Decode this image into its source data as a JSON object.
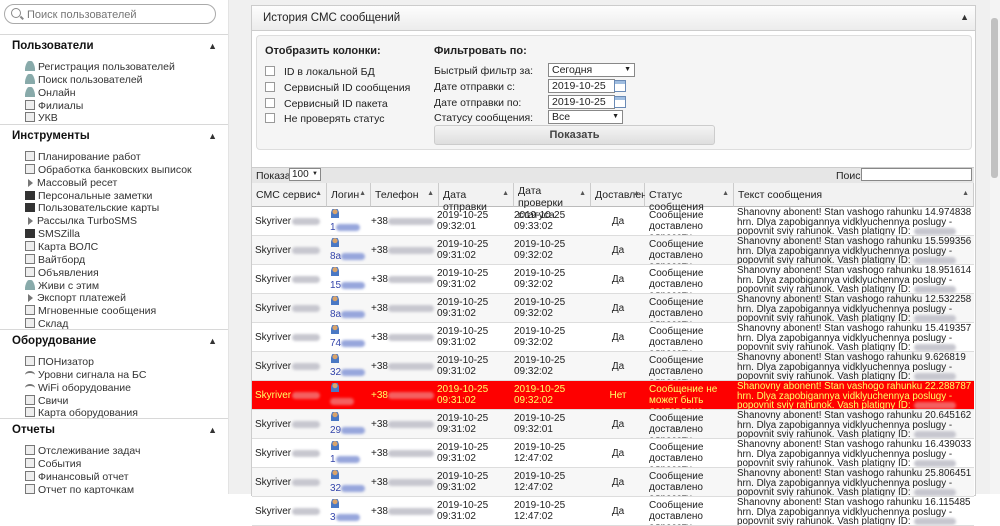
{
  "sidebar": {
    "search_placeholder": "Поиск пользователей",
    "sections": [
      {
        "title": "Пользователи",
        "items": [
          {
            "label": "Регистрация пользователей",
            "icon": "person-icon"
          },
          {
            "label": "Поиск пользователей",
            "icon": "person-icon"
          },
          {
            "label": "Онлайн",
            "icon": "people-icon"
          },
          {
            "label": "Филиалы",
            "icon": "folders-icon"
          },
          {
            "label": "УКВ",
            "icon": "box-icon"
          }
        ]
      },
      {
        "title": "Инструменты",
        "items": [
          {
            "label": "Планирование работ",
            "icon": "calendar-icon"
          },
          {
            "label": "Обработка банковских выписок",
            "icon": "bank-icon"
          },
          {
            "label": "Массовый ресет",
            "icon": "arrow-icon"
          },
          {
            "label": "Персональные заметки",
            "icon": "notes-icon"
          },
          {
            "label": "Пользовательские карты",
            "icon": "cards-icon"
          },
          {
            "label": "Рассылка TurboSMS",
            "icon": "arrow-icon"
          },
          {
            "label": "SMSZilla",
            "icon": "sms-icon"
          },
          {
            "label": "Карта ВОЛС",
            "icon": "map-icon"
          },
          {
            "label": "Вайтборд",
            "icon": "board-icon"
          },
          {
            "label": "Объявления",
            "icon": "announce-icon"
          },
          {
            "label": "Живи с этим",
            "icon": "people-icon"
          },
          {
            "label": "Экспорт платежей",
            "icon": "arrow-icon"
          },
          {
            "label": "Мгновенные сообщения",
            "icon": "chat-icon"
          },
          {
            "label": "Склад",
            "icon": "warehouse-icon"
          }
        ]
      },
      {
        "title": "Оборудование",
        "items": [
          {
            "label": "ПОНизатор",
            "icon": "device-icon"
          },
          {
            "label": "Уровни сигнала на БС",
            "icon": "signal-icon"
          },
          {
            "label": "WiFi оборудование",
            "icon": "wifi-icon"
          },
          {
            "label": "Свичи",
            "icon": "switch-icon"
          },
          {
            "label": "Карта оборудования",
            "icon": "map-icon"
          }
        ]
      },
      {
        "title": "Отчеты",
        "items": [
          {
            "label": "Отслеживание задач",
            "icon": "tasks-icon"
          },
          {
            "label": "События",
            "icon": "events-icon"
          },
          {
            "label": "Финансовый отчет",
            "icon": "finance-icon"
          },
          {
            "label": "Отчет по карточкам",
            "icon": "report-icon"
          }
        ]
      }
    ]
  },
  "panel": {
    "title": "История СМС сообщений",
    "columns_heading": "Отобразить колонки:",
    "filter_heading": "Фильтровать по:",
    "checkboxes": [
      "ID в локальной БД",
      "Сервисный ID сообщения",
      "Сервисный ID пакета",
      "Не проверять статус"
    ],
    "quick_filter_label": "Быстрый фильтр за:",
    "quick_filter_value": "Сегодня",
    "date_from_label": "Дате отправки с:",
    "date_from_value": "2019-10-25",
    "date_to_label": "Дате отправки по:",
    "date_to_value": "2019-10-25",
    "status_label": "Статусу сообщения:",
    "status_value": "Все",
    "show_button": "Показать"
  },
  "table": {
    "show_label": "Показать",
    "page_size": "100",
    "search_label": "Поиск",
    "headers": [
      "СМС сервис",
      "Логин",
      "Телефон",
      "Дата отправки",
      "Дата проверки статуса",
      "Доставлено",
      "Статус сообщения",
      "Текст сообщения"
    ],
    "rows": [
      {
        "service": "Skyriver",
        "login": "1",
        "phone": "+38",
        "sent": "2019-10-25 09:32:01",
        "checked": "2019-10-25 09:33:02",
        "delivered": "Да",
        "status": "Сообщение доставлено адресату",
        "text": "Shanovny abonent! Stan vashogo rahunku 14.974838 hrn. Dlya zapobigannya vidklyuchennya poslugy - popovnit sviy rahunok. Vash platigny ID:",
        "error": false
      },
      {
        "service": "Skyriver",
        "login": "8a",
        "phone": "+38",
        "sent": "2019-10-25 09:31:02",
        "checked": "2019-10-25 09:32:02",
        "delivered": "Да",
        "status": "Сообщение доставлено адресату",
        "text": "Shanovny abonent! Stan vashogo rahunku 15.599356 hrn. Dlya zapobigannya vidklyuchennya poslugy - popovnit sviy rahunok. Vash platigny ID:",
        "error": false
      },
      {
        "service": "Skyriver",
        "login": "15",
        "phone": "+38",
        "sent": "2019-10-25 09:31:02",
        "checked": "2019-10-25 09:32:02",
        "delivered": "Да",
        "status": "Сообщение доставлено адресату",
        "text": "Shanovny abonent! Stan vashogo rahunku 18.951614 hrn. Dlya zapobigannya vidklyuchennya poslugy - popovnit sviy rahunok. Vash platigny ID:",
        "error": false
      },
      {
        "service": "Skyriver",
        "login": "8a",
        "phone": "+38",
        "sent": "2019-10-25 09:31:02",
        "checked": "2019-10-25 09:32:02",
        "delivered": "Да",
        "status": "Сообщение доставлено адресату",
        "text": "Shanovny abonent! Stan vashogo rahunku 12.532258 hrn. Dlya zapobigannya vidklyuchennya poslugy - popovnit sviy rahunok. Vash platigny ID:",
        "error": false
      },
      {
        "service": "Skyriver",
        "login": "74",
        "phone": "+38",
        "sent": "2019-10-25 09:31:02",
        "checked": "2019-10-25 09:32:02",
        "delivered": "Да",
        "status": "Сообщение доставлено адресату",
        "text": "Shanovny abonent! Stan vashogo rahunku 15.419357 hrn. Dlya zapobigannya vidklyuchennya poslugy - popovnit sviy rahunok. Vash platigny ID:",
        "error": false
      },
      {
        "service": "Skyriver",
        "login": "32",
        "phone": "+38",
        "sent": "2019-10-25 09:31:02",
        "checked": "2019-10-25 09:32:02",
        "delivered": "Да",
        "status": "Сообщение доставлено адресату",
        "text": "Shanovny abonent! Stan vashogo rahunku 9.626819 hrn. Dlya zapobigannya vidklyuchennya poslugy - popovnit sviy rahunok. Vash platigny ID:",
        "error": false
      },
      {
        "service": "Skyriver",
        "login": "",
        "phone": "+38",
        "sent": "2019-10-25 09:31:02",
        "checked": "2019-10-25 09:32:02",
        "delivered": "Нет",
        "status": "Сообщение не может быть доставлено адресату",
        "text": "Shanovny abonent! Stan vashogo rahunku 22.288787 hrn. Dlya zapobigannya vidklyuchennya poslugy - popovnit sviy rahunok. Vash platigny ID:",
        "error": true
      },
      {
        "service": "Skyriver",
        "login": "29",
        "phone": "+38",
        "sent": "2019-10-25 09:31:02",
        "checked": "2019-10-25 09:32:01",
        "delivered": "Да",
        "status": "Сообщение доставлено адресату",
        "text": "Shanovny abonent! Stan vashogo rahunku 20.645162 hrn. Dlya zapobigannya vidklyuchennya poslugy - popovnit sviy rahunok. Vash platigny ID:",
        "error": false
      },
      {
        "service": "Skyriver",
        "login": "1",
        "phone": "+38",
        "sent": "2019-10-25 09:31:02",
        "checked": "2019-10-25 12:47:02",
        "delivered": "Да",
        "status": "Сообщение доставлено адресату",
        "text": "Shanovny abonent! Stan vashogo rahunku 16.439033 hrn. Dlya zapobigannya vidklyuchennya poslugy - popovnit sviy rahunok. Vash platigny ID:",
        "error": false
      },
      {
        "service": "Skyriver",
        "login": "32",
        "phone": "+38",
        "sent": "2019-10-25 09:31:02",
        "checked": "2019-10-25 12:47:02",
        "delivered": "Да",
        "status": "Сообщение доставлено адресату",
        "text": "Shanovny abonent! Stan vashogo rahunku 25.806451 hrn. Dlya zapobigannya vidklyuchennya poslugy - popovnit sviy rahunok. Vash platigny ID:",
        "error": false
      },
      {
        "service": "Skyriver",
        "login": "3",
        "phone": "+38",
        "sent": "2019-10-25 09:31:02",
        "checked": "2019-10-25 12:47:02",
        "delivered": "Да",
        "status": "Сообщение доставлено адресату",
        "text": "Shanovny abonent! Stan vashogo rahunku 16.115485 hrn. Dlya zapobigannya vidklyuchennya poslugy - popovnit sviy rahunok. Vash platigny ID:",
        "error": false
      }
    ]
  },
  "colors": {
    "error_row": "#fe0000",
    "error_text": "#ffff66",
    "link": "#3344aa"
  }
}
